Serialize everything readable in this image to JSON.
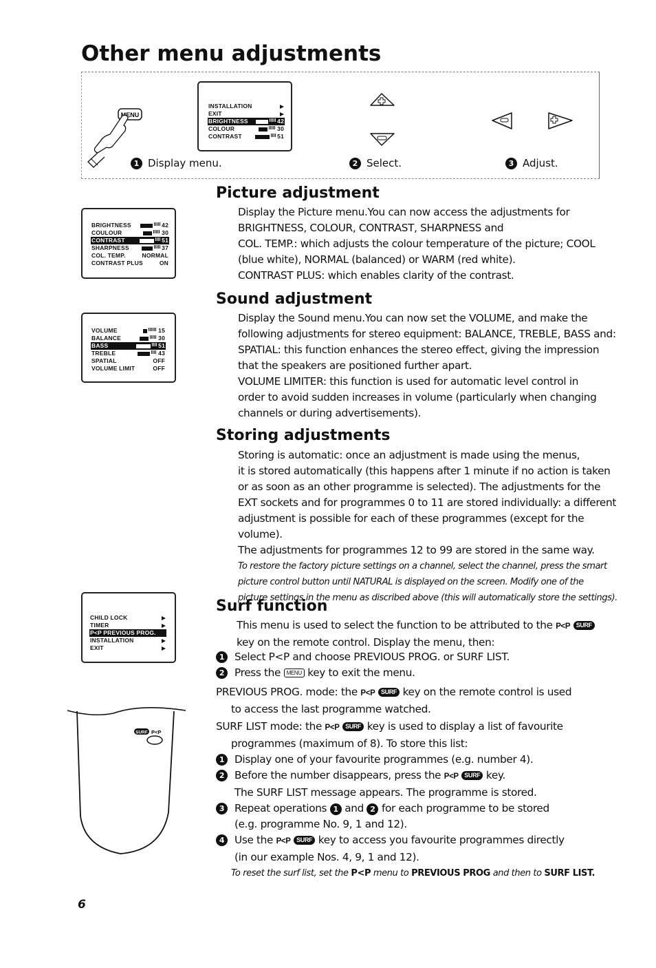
{
  "page": {
    "title": "Other menu adjustments",
    "page_number": "6"
  },
  "steps": [
    {
      "num": "1",
      "label": "Display menu.",
      "key_label": "MENU"
    },
    {
      "num": "2",
      "label": "Select."
    },
    {
      "num": "3",
      "label": "Adjust."
    }
  ],
  "main_menu": {
    "rows": [
      {
        "label": "INSTALLATION",
        "type": "arrow"
      },
      {
        "label": "EXIT",
        "type": "arrow"
      },
      {
        "label": "BRIGHTNESS",
        "type": "bar",
        "value": "42",
        "level": 42,
        "selected": true
      },
      {
        "label": "COLOUR",
        "type": "bar",
        "value": "30",
        "level": 30
      },
      {
        "label": "CONTRAST",
        "type": "bar",
        "value": "51",
        "level": 51
      }
    ]
  },
  "picture_menu": {
    "rows": [
      {
        "label": "BRIGHTNESS",
        "value": "42",
        "level": 42
      },
      {
        "label": "COULOUR",
        "value": "30",
        "level": 30
      },
      {
        "label": "CONTRAST",
        "value": "51",
        "level": 51,
        "selected": true
      },
      {
        "label": "SHARPNESS",
        "value": "37",
        "level": 37
      },
      {
        "label": "COL. TEMP.",
        "value": "NORMAL"
      },
      {
        "label": "CONTRAST PLUS",
        "value": "ON"
      }
    ]
  },
  "sound_menu": {
    "rows": [
      {
        "label": "VOLUME",
        "value": "15",
        "level": 15
      },
      {
        "label": "BALANCE",
        "value": "30",
        "level": 30
      },
      {
        "label": "BASS",
        "value": "51",
        "level": 51,
        "selected": true
      },
      {
        "label": "TREBLE",
        "value": "43",
        "level": 43
      },
      {
        "label": "SPATIAL",
        "value": "OFF"
      },
      {
        "label": "VOLUME LIMIT",
        "value": "OFF"
      }
    ]
  },
  "features_menu": {
    "rows": [
      {
        "label": "CHILD LOCK"
      },
      {
        "label": "TIMER"
      },
      {
        "label": "P<P PREVIOUS PROG.",
        "selected": true
      },
      {
        "label": "INSTALLATION"
      },
      {
        "label": "EXIT"
      }
    ]
  },
  "remote": {
    "surf_label": "SURF",
    "pp_label": "P<P"
  },
  "sections": {
    "picture": {
      "heading": "Picture adjustment",
      "lines": [
        "Display the Picture menu.You can now access the adjustments for",
        "BRIGHTNESS, COLOUR, CONTRAST, SHARPNESS and",
        "COL. TEMP.: which adjusts the colour temperature of the picture; COOL",
        "(blue white), NORMAL (balanced) or WARM (red white).",
        "CONTRAST PLUS: which enables clarity of the contrast."
      ]
    },
    "sound": {
      "heading": "Sound adjustment",
      "lines": [
        "Display the Sound menu.You can now set the VOLUME, and make the",
        "following adjustments for stereo equipment: BALANCE, TREBLE, BASS and:",
        "SPATIAL: this function enhances the stereo effect, giving the impression",
        "that the speakers are positioned further apart.",
        "VOLUME LIMITER: this function is used for automatic level control in",
        "order to avoid sudden increases in volume (particularly when changing",
        "channels or during advertisements)."
      ]
    },
    "storing": {
      "heading": "Storing adjustments",
      "lines": [
        "Storing is automatic: once an adjustment is made using the menus,",
        "it is stored automatically (this happens after 1 minute if no action is taken",
        "or as soon as an other programme is selected). The adjustments for the",
        "EXT sockets and for programmes 0 to 11 are stored individually: a different",
        "adjustment is possible for each of these programmes (except for the volume).",
        "The adjustments for programmes 12 to 99 are stored in the same way."
      ],
      "note_lines": [
        "To restore the factory picture settings on a channel, select the channel, press the smart",
        "picture control button until NATURAL is displayed on the screen. Modify one of the",
        "picture settings in the menu as discribed above (this will automatically store the settings)."
      ]
    },
    "surf": {
      "heading": "Surf function",
      "intro_a": "This menu is used to select the function to be attributed to the",
      "intro_b": "key on the remote control. Display the menu, then:",
      "steps": [
        {
          "num": "1",
          "text": "Select P<P and choose PREVIOUS PROG. or SURF LIST."
        },
        {
          "num": "2",
          "text_a": "Press the",
          "key": "MENU",
          "text_b": "key to exit the menu."
        }
      ],
      "prev_mode_label": "PREVIOUS PROG. mode:",
      "prev_mode_a": "the",
      "prev_mode_b": "key on the remote control is used",
      "prev_mode_c": "to access the last programme watched.",
      "list_mode_label": "SURF LIST mode:",
      "list_mode_a": "the",
      "list_mode_b": "key is used to display a list of favourite",
      "list_mode_c": "programmes (maximum of 8). To store this list:",
      "list_steps": [
        {
          "num": "1",
          "text": "Display one of your favourite programmes (e.g. number 4)."
        },
        {
          "num": "2",
          "text_a": "Before the number disappears, press the",
          "text_b": "key.",
          "text_c": "The SURF LIST message appears. The programme is stored."
        },
        {
          "num": "3",
          "text_a": "Repeat operations",
          "ref1": "1",
          "text_b": "and",
          "ref2": "2",
          "text_c": "for each programme to be stored",
          "text_d": "(e.g. programme No. 9, 1 and 12)."
        },
        {
          "num": "4",
          "text_a": "Use the",
          "text_b": "key to access you favourite programmes directly",
          "text_c": "(in our example Nos. 4, 9, 1 and 12)."
        }
      ],
      "footnote_a": "To reset the surf list, set the",
      "footnote_b": "P<P",
      "footnote_c": "menu to",
      "footnote_d": "PREVIOUS PROG",
      "footnote_e": "and then to",
      "footnote_f": "SURF LIST."
    }
  }
}
